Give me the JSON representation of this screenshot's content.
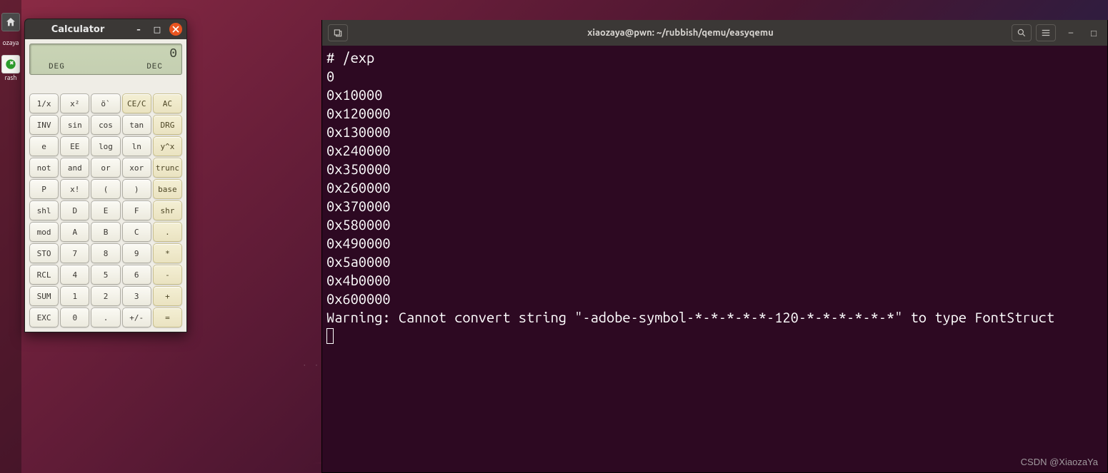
{
  "dock": {
    "items": [
      {
        "name": "files-icon",
        "label": "",
        "type": "home"
      },
      {
        "name": "text-icon",
        "label": "ozaya",
        "type": "df"
      },
      {
        "name": "trash-icon",
        "label": "rash",
        "type": "tr"
      }
    ]
  },
  "calculator": {
    "title": "Calculator",
    "display_value": "0",
    "mode_left": "DEG",
    "mode_right": "DEC",
    "rows": [
      [
        {
          "l": "1/x"
        },
        {
          "l": "x²"
        },
        {
          "l": "ö`"
        },
        {
          "l": "CE/C",
          "alt": true
        },
        {
          "l": "AC",
          "alt": true
        }
      ],
      [
        {
          "l": "INV"
        },
        {
          "l": "sin"
        },
        {
          "l": "cos"
        },
        {
          "l": "tan"
        },
        {
          "l": "DRG",
          "alt": true
        }
      ],
      [
        {
          "l": "e"
        },
        {
          "l": "EE"
        },
        {
          "l": "log"
        },
        {
          "l": "ln"
        },
        {
          "l": "y^x",
          "alt": true
        }
      ],
      [
        {
          "l": "not"
        },
        {
          "l": "and"
        },
        {
          "l": "or"
        },
        {
          "l": "xor"
        },
        {
          "l": "trunc",
          "alt": true
        }
      ],
      [
        {
          "l": "P"
        },
        {
          "l": "x!"
        },
        {
          "l": "("
        },
        {
          "l": ")"
        },
        {
          "l": "base",
          "alt": true
        }
      ],
      [
        {
          "l": "shl"
        },
        {
          "l": "D"
        },
        {
          "l": "E"
        },
        {
          "l": "F"
        },
        {
          "l": "shr",
          "alt": true
        }
      ],
      [
        {
          "l": "mod"
        },
        {
          "l": "A"
        },
        {
          "l": "B"
        },
        {
          "l": "C"
        },
        {
          "l": ".",
          "alt": true
        }
      ],
      [
        {
          "l": "STO"
        },
        {
          "l": "7"
        },
        {
          "l": "8"
        },
        {
          "l": "9"
        },
        {
          "l": "*",
          "alt": true
        }
      ],
      [
        {
          "l": "RCL"
        },
        {
          "l": "4"
        },
        {
          "l": "5"
        },
        {
          "l": "6"
        },
        {
          "l": "-",
          "alt": true
        }
      ],
      [
        {
          "l": "SUM"
        },
        {
          "l": "1"
        },
        {
          "l": "2"
        },
        {
          "l": "3"
        },
        {
          "l": "+",
          "alt": true
        }
      ],
      [
        {
          "l": "EXC"
        },
        {
          "l": "0"
        },
        {
          "l": "."
        },
        {
          "l": "+/-"
        },
        {
          "l": "=",
          "alt": true
        }
      ]
    ]
  },
  "terminal": {
    "title": "xiaozaya@pwn: ~/rubbish/qemu/easyqemu",
    "lines": [
      "# /exp",
      "0",
      "0x10000",
      "0x120000",
      "0x130000",
      "0x240000",
      "0x350000",
      "0x260000",
      "0x370000",
      "0x580000",
      "0x490000",
      "0x5a0000",
      "0x4b0000",
      "0x600000",
      "Warning: Cannot convert string \"-adobe-symbol-*-*-*-*-*-120-*-*-*-*-*-*\" to type FontStruct"
    ]
  },
  "watermark": "CSDN @XiaozaYa"
}
